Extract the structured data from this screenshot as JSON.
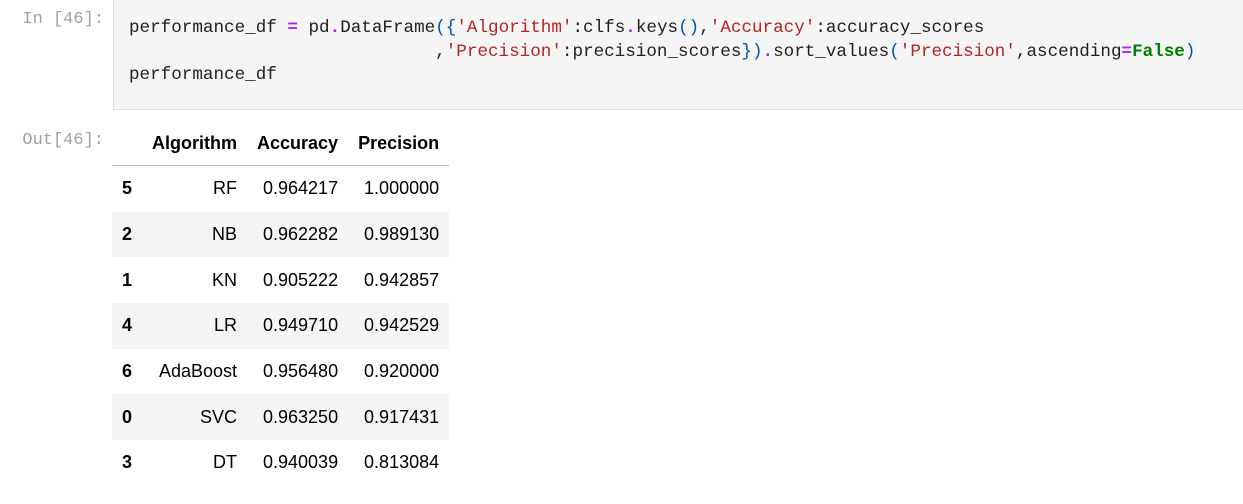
{
  "cell_in": {
    "prompt": "In [46]:",
    "lines": [
      [
        [
          "n",
          "performance_df "
        ],
        [
          "op",
          "="
        ],
        [
          "n",
          " pd"
        ],
        [
          "op",
          "."
        ],
        [
          "n",
          "DataFrame"
        ],
        [
          "p",
          "({"
        ],
        [
          "str",
          "'Algorithm'"
        ],
        [
          "n",
          ":clfs"
        ],
        [
          "op",
          "."
        ],
        [
          "n",
          "keys"
        ],
        [
          "p",
          "()"
        ],
        [
          "n",
          ","
        ],
        [
          "str",
          "'Accuracy'"
        ],
        [
          "n",
          ":accuracy_scores"
        ]
      ],
      [
        [
          "n",
          "                             ,"
        ],
        [
          "str",
          "'Precision'"
        ],
        [
          "n",
          ":precision_scores"
        ],
        [
          "p",
          "})"
        ],
        [
          "op",
          "."
        ],
        [
          "n",
          "sort_values"
        ],
        [
          "p",
          "("
        ],
        [
          "str",
          "'Precision'"
        ],
        [
          "n",
          ",ascending"
        ],
        [
          "op",
          "="
        ],
        [
          "kw",
          "False"
        ],
        [
          "p",
          ")"
        ]
      ],
      [
        [
          "n",
          "performance_df"
        ]
      ]
    ]
  },
  "cell_out": {
    "prompt": "Out[46]:",
    "table": {
      "columns": [
        "",
        "Algorithm",
        "Accuracy",
        "Precision"
      ],
      "rows": [
        [
          "5",
          "RF",
          "0.964217",
          "1.000000"
        ],
        [
          "2",
          "NB",
          "0.962282",
          "0.989130"
        ],
        [
          "1",
          "KN",
          "0.905222",
          "0.942857"
        ],
        [
          "4",
          "LR",
          "0.949710",
          "0.942529"
        ],
        [
          "6",
          "AdaBoost",
          "0.956480",
          "0.920000"
        ],
        [
          "0",
          "SVC",
          "0.963250",
          "0.917431"
        ],
        [
          "3",
          "DT",
          "0.940039",
          "0.813084"
        ]
      ]
    }
  }
}
